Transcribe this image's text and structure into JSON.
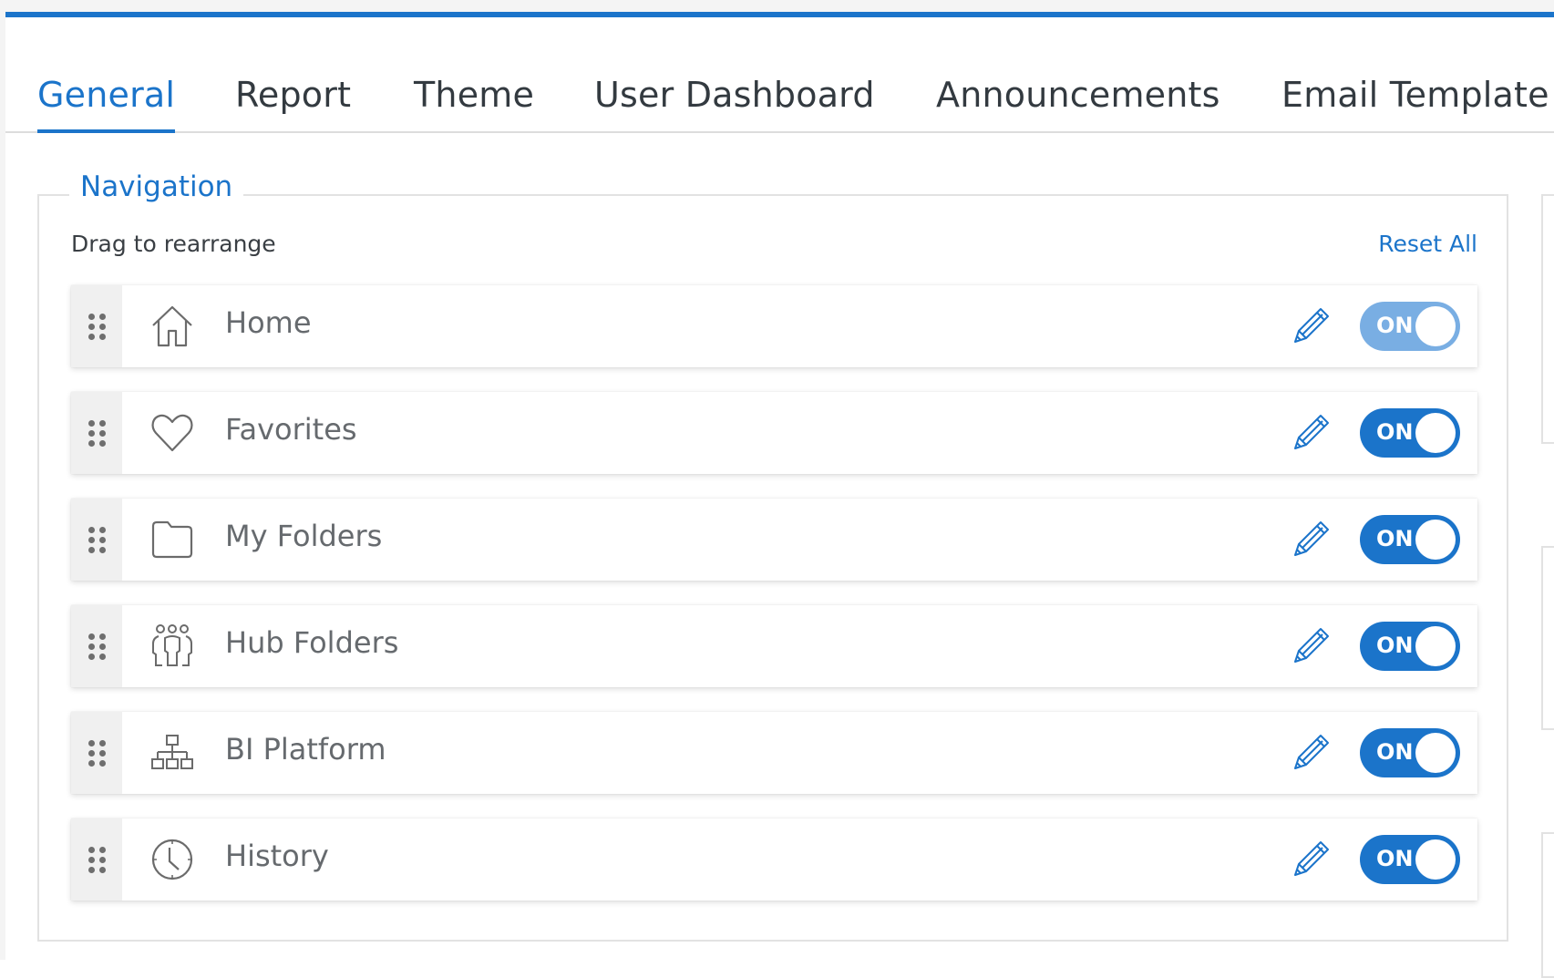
{
  "tabs": [
    {
      "label": "General",
      "active": true
    },
    {
      "label": "Report",
      "active": false
    },
    {
      "label": "Theme",
      "active": false
    },
    {
      "label": "User Dashboard",
      "active": false
    },
    {
      "label": "Announcements",
      "active": false
    },
    {
      "label": "Email Template",
      "active": false
    }
  ],
  "navigation": {
    "legend": "Navigation",
    "hint": "Drag to rearrange",
    "reset_label": "Reset All",
    "items": [
      {
        "label": "Home",
        "icon": "home-icon",
        "toggle": "ON",
        "enabled": true,
        "toggle_disabled": true
      },
      {
        "label": "Favorites",
        "icon": "heart-icon",
        "toggle": "ON",
        "enabled": true,
        "toggle_disabled": false
      },
      {
        "label": "My Folders",
        "icon": "folder-icon",
        "toggle": "ON",
        "enabled": true,
        "toggle_disabled": false
      },
      {
        "label": "Hub Folders",
        "icon": "users-icon",
        "toggle": "ON",
        "enabled": true,
        "toggle_disabled": false
      },
      {
        "label": "BI Platform",
        "icon": "org-chart-icon",
        "toggle": "ON",
        "enabled": true,
        "toggle_disabled": false
      },
      {
        "label": "History",
        "icon": "clock-icon",
        "toggle": "ON",
        "enabled": true,
        "toggle_disabled": false
      }
    ]
  },
  "colors": {
    "accent": "#1b74ca",
    "toggle_disabled": "#79aee3",
    "text": "#333a40",
    "muted": "#666a6e"
  }
}
